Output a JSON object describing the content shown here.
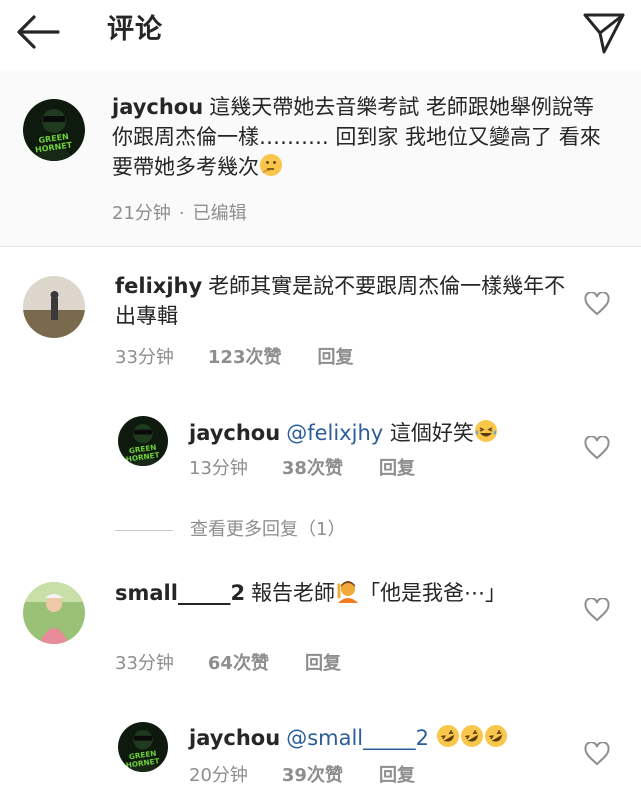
{
  "header": {
    "title": "评论",
    "back_icon": "back-arrow-icon",
    "send_icon": "send-icon"
  },
  "caption": {
    "username": "jaychou",
    "text": "這幾天帶她去音樂考試 老師跟她舉例說等你跟周杰倫一樣………. 回到家 我地位又變高了 看來要帶她多考幾次",
    "emoji": "thinking-face-icon",
    "time": "21分钟",
    "edited": "已编辑",
    "avatar_text": "GREEN HORNET"
  },
  "comments": [
    {
      "username": "felixjhy",
      "text": "老師其實是說不要跟周杰倫一樣幾年不出專輯",
      "time": "33分钟",
      "likes": "123次赞",
      "reply_label": "回复",
      "reply": {
        "username": "jaychou",
        "mention": "@felixjhy",
        "text": "這個好笑",
        "time": "13分钟",
        "likes": "38次赞",
        "reply_label": "回复"
      },
      "view_more": "查看更多回复（1）"
    },
    {
      "username": "small_____2",
      "text_before": "報告老師",
      "text_after": "「他是我爸⋯」",
      "time": "33分钟",
      "likes": "64次赞",
      "reply_label": "回复",
      "reply": {
        "username": "jaychou",
        "mention": "@small_____2",
        "time": "20分钟",
        "likes": "39次赞",
        "reply_label": "回复"
      }
    }
  ],
  "colors": {
    "text": "#262626",
    "meta": "#8e8e8e",
    "mention": "#2b5d9c",
    "caption_bg": "#fafafa"
  }
}
